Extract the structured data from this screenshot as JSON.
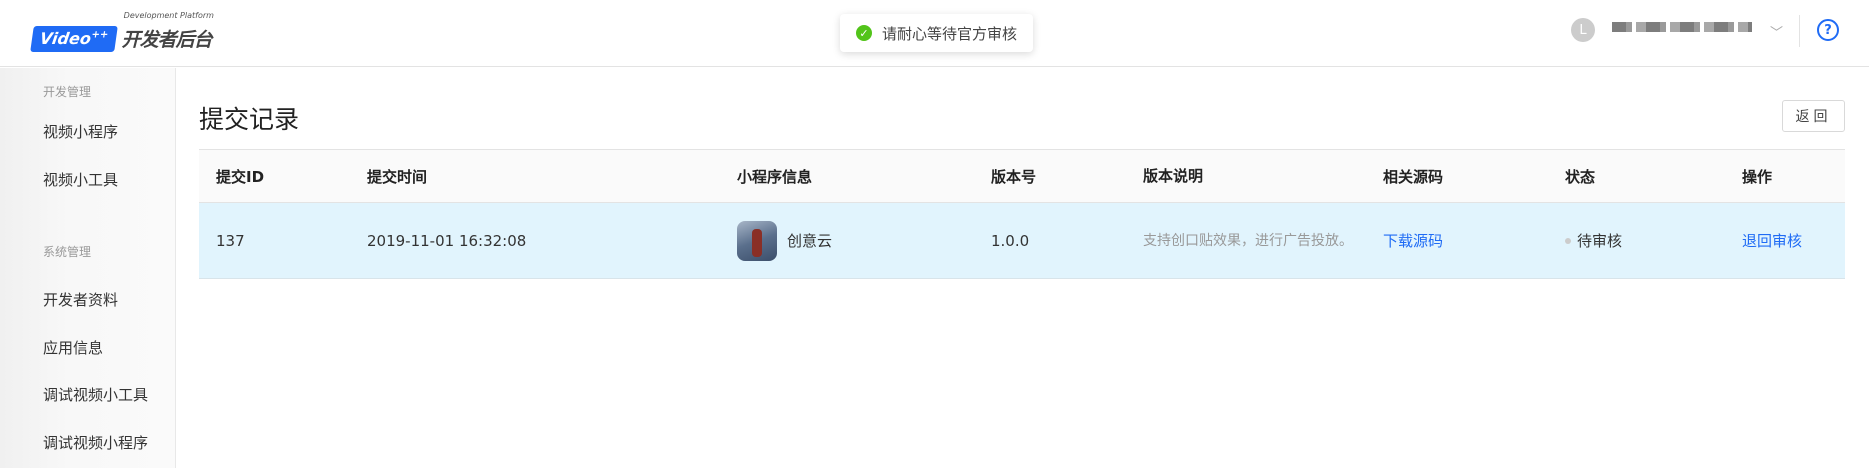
{
  "header": {
    "logo_badge": "Video",
    "logo_plus": "++",
    "logo_sub": "Development Platform",
    "logo_main": "开发者后台",
    "avatar_letter": "L",
    "help": "?"
  },
  "toast": {
    "message": "请耐心等待官方审核"
  },
  "sidebar": {
    "groups": [
      {
        "label": "开发管理"
      },
      {
        "label": "系统管理"
      }
    ],
    "items": [
      {
        "label": "视频小程序"
      },
      {
        "label": "视频小工具"
      },
      {
        "label": "开发者资料"
      },
      {
        "label": "应用信息"
      },
      {
        "label": "调试视频小工具"
      },
      {
        "label": "调试视频小程序"
      }
    ]
  },
  "page": {
    "title": "提交记录",
    "back_label": "返回"
  },
  "table": {
    "columns": [
      "提交ID",
      "提交时间",
      "小程序信息",
      "版本号",
      "版本说明",
      "相关源码",
      "状态",
      "操作"
    ],
    "rows": [
      {
        "id": "137",
        "time": "2019-11-01 16:32:08",
        "app_name": "创意云",
        "version": "1.0.0",
        "description": "支持创口贴效果，进行广告投放。",
        "source": "下载源码",
        "status": "待审核",
        "action": "退回审核"
      }
    ]
  },
  "colors": {
    "accent": "#1f6bf5",
    "row_highlight": "#e1f4fd",
    "success": "#52c41a"
  }
}
